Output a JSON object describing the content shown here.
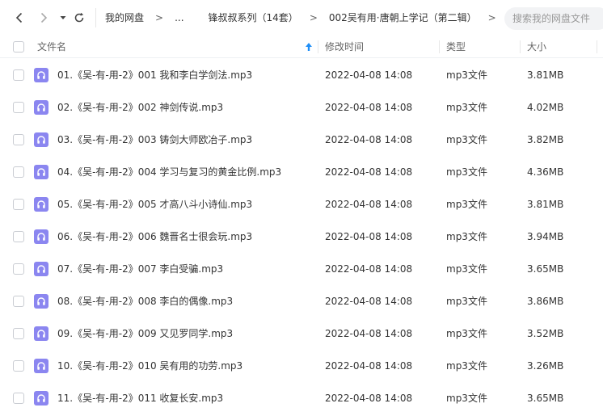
{
  "toolbar": {
    "breadcrumb": [
      "我的网盘",
      "...",
      "锋叔叔系列（14套）",
      "002吴有用·唐朝上学记（第二辑）"
    ],
    "separator": ">",
    "search_placeholder": "搜索我的网盘文件"
  },
  "columns": {
    "name": "文件名",
    "modified": "修改时间",
    "type": "类型",
    "size": "大小"
  },
  "files": [
    {
      "name": "01.《吴-有-用-2》001 我和李白学剑法.mp3",
      "modified": "2022-04-08 14:08",
      "type": "mp3文件",
      "size": "3.81MB"
    },
    {
      "name": "02.《吴-有-用-2》002 神剑传说.mp3",
      "modified": "2022-04-08 14:08",
      "type": "mp3文件",
      "size": "4.02MB"
    },
    {
      "name": "03.《吴-有-用-2》003 铸剑大师欧冶子.mp3",
      "modified": "2022-04-08 14:08",
      "type": "mp3文件",
      "size": "3.82MB"
    },
    {
      "name": "04.《吴-有-用-2》004 学习与复习的黄金比例.mp3",
      "modified": "2022-04-08 14:08",
      "type": "mp3文件",
      "size": "4.36MB"
    },
    {
      "name": "05.《吴-有-用-2》005 才高八斗小诗仙.mp3",
      "modified": "2022-04-08 14:08",
      "type": "mp3文件",
      "size": "3.81MB"
    },
    {
      "name": "06.《吴-有-用-2》006 魏晋名士很会玩.mp3",
      "modified": "2022-04-08 14:08",
      "type": "mp3文件",
      "size": "3.94MB"
    },
    {
      "name": "07.《吴-有-用-2》007 李白受骗.mp3",
      "modified": "2022-04-08 14:08",
      "type": "mp3文件",
      "size": "3.65MB"
    },
    {
      "name": "08.《吴-有-用-2》008 李白的偶像.mp3",
      "modified": "2022-04-08 14:08",
      "type": "mp3文件",
      "size": "3.86MB"
    },
    {
      "name": "09.《吴-有-用-2》009 又见罗同学.mp3",
      "modified": "2022-04-08 14:08",
      "type": "mp3文件",
      "size": "3.52MB"
    },
    {
      "name": "10.《吴-有-用-2》010 吴有用的功劳.mp3",
      "modified": "2022-04-08 14:08",
      "type": "mp3文件",
      "size": "3.26MB"
    },
    {
      "name": "11.《吴-有-用-2》011 收复长安.mp3",
      "modified": "2022-04-08 14:08",
      "type": "mp3文件",
      "size": "3.65MB"
    }
  ],
  "colors": {
    "accent": "#1e8ef7",
    "file_icon": "#8b86f0"
  },
  "icons": {
    "back": "chevron-left-icon",
    "forward": "chevron-right-icon",
    "history": "caret-down-icon",
    "refresh": "refresh-icon",
    "sort": "sort-ascending-icon",
    "file": "audio-file-icon"
  }
}
